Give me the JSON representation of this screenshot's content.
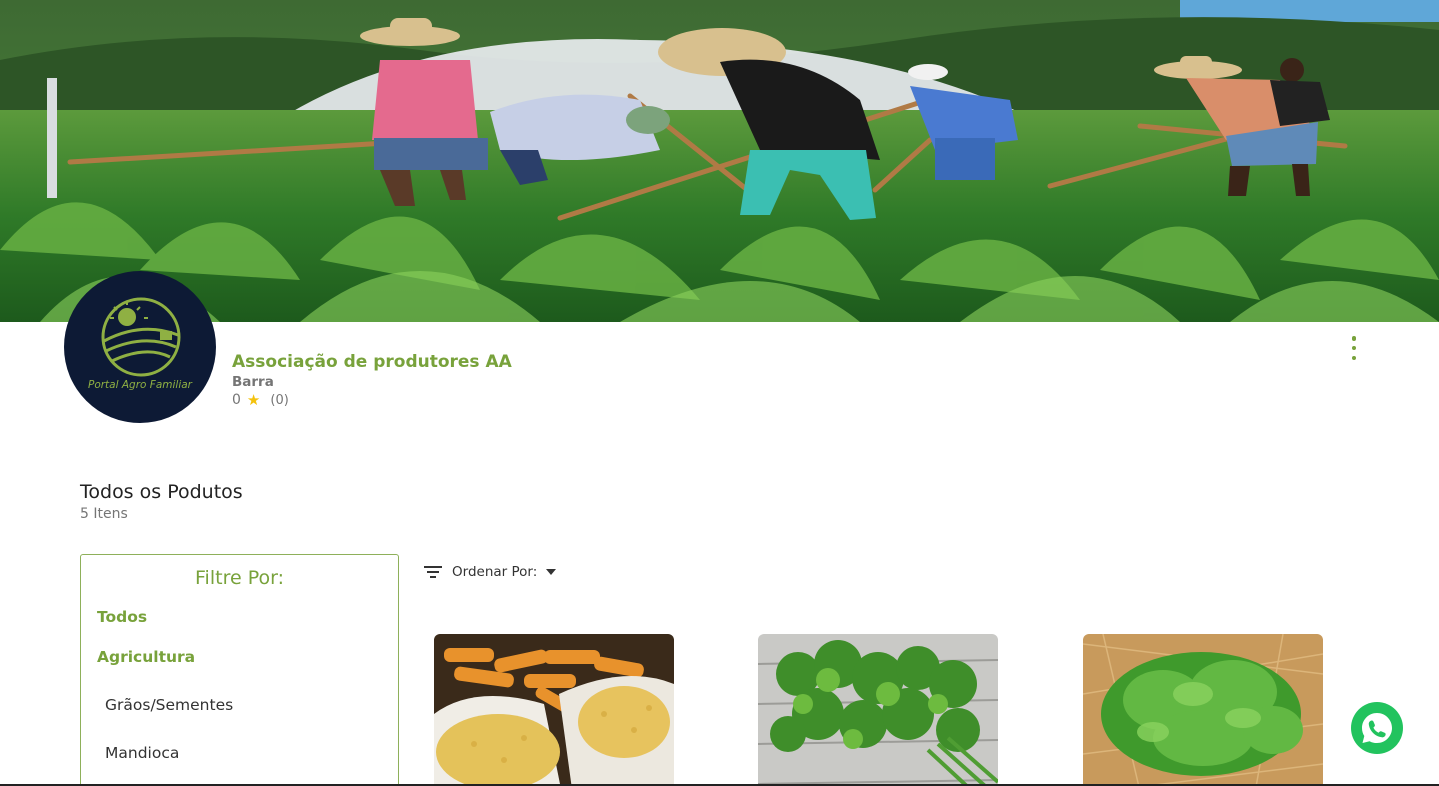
{
  "store": {
    "logo_text": "Portal Agro Familiar",
    "name": "Associação de produtores AA",
    "city": "Barra",
    "rating_value": "0",
    "rating_count": "(0)"
  },
  "products_section": {
    "title": "Todos os Podutos",
    "count_label": "5 Itens"
  },
  "filter": {
    "title": "Filtre Por:",
    "items": [
      {
        "label": "Todos",
        "type": "category"
      },
      {
        "label": "Agricultura",
        "type": "category"
      },
      {
        "label": "Grãos/Sementes",
        "type": "subcategory"
      },
      {
        "label": "Mandioca",
        "type": "subcategory"
      }
    ]
  },
  "sort": {
    "label": "Ordenar Por:",
    "icon": "sort-icon"
  },
  "products": [
    {
      "image": "corn-grains-sacks"
    },
    {
      "image": "cilantro-bunch"
    },
    {
      "image": "lettuce-head"
    }
  ],
  "colors": {
    "brand_green": "#78a23b",
    "whatsapp_green": "#22c35e",
    "avatar_navy": "#0d1a35",
    "star_yellow": "#f4c20d"
  },
  "icons": {
    "menu": "more-vert-icon",
    "whatsapp": "whatsapp-icon",
    "star": "star-icon"
  }
}
